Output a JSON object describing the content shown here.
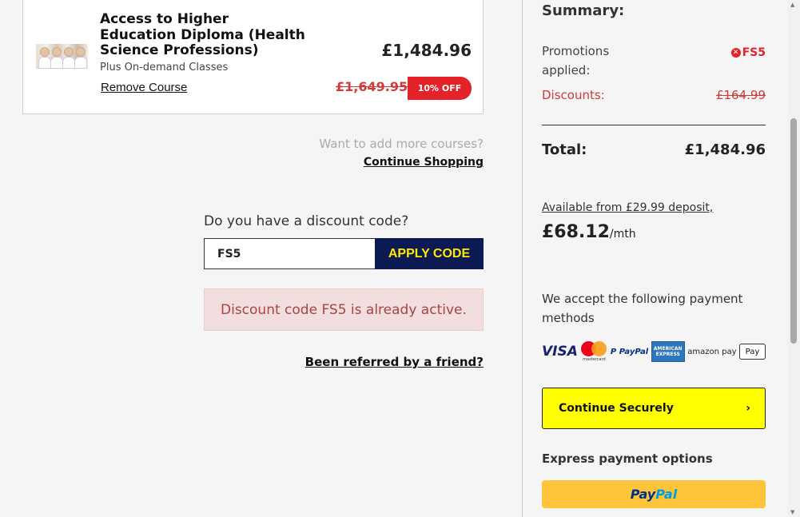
{
  "cart": {
    "course_title": "Access to Higher Education Diploma (Health Science Professions)",
    "course_subtitle": "Plus On-demand Classes",
    "remove_label": "Remove Course",
    "price": "£1,484.96",
    "old_price": "£1,649.95",
    "discount_badge": "10% OFF"
  },
  "more_courses": {
    "question": "Want to add more courses?",
    "link": "Continue Shopping"
  },
  "discount": {
    "label": "Do you have a discount code?",
    "input_value": "FS5",
    "apply_label": "APPLY CODE",
    "alert": "Discount code FS5 is already active."
  },
  "referral": {
    "link": "Been referred by a friend?"
  },
  "summary": {
    "title": "Summary:",
    "promotions_label": "Promotions applied:",
    "promotion_code": "FS5",
    "discounts_label": "Discounts:",
    "discounts_value": "£164.99",
    "total_label": "Total:",
    "total_value": "£1,484.96",
    "deposit_text": "Available from £29.99 deposit,",
    "monthly_amount": "£68.12",
    "monthly_period": "/mth",
    "accept_text": "We accept the following payment methods",
    "payment_methods": {
      "visa": "VISA",
      "mastercard": "mastercard",
      "paypal_a": "P PayPal",
      "amex": "AMERICAN EXPRESS",
      "amazon": "amazon pay",
      "applepay": " Pay"
    },
    "continue_label": "Continue Securely",
    "express_label": "Express payment options",
    "paypal_button": {
      "pay": "Pay",
      "pal": "Pal"
    }
  },
  "colors": {
    "accent_red": "#e3222a",
    "navy": "#0b1a52",
    "yellow": "#ffff00",
    "paypal_yellow": "#ffc439"
  }
}
